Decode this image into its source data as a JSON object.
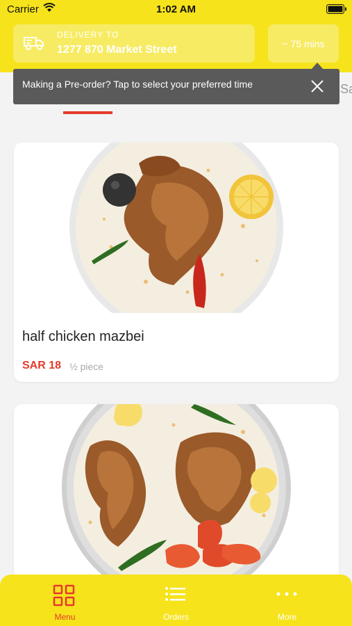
{
  "status_bar": {
    "carrier": "Carrier",
    "time": "1:02 AM"
  },
  "delivery": {
    "label": "DELIVERY TO",
    "address": "1277 870 Market Street",
    "eta": "~ 75 mins"
  },
  "tooltip": {
    "text": "Making a Pre-order? Tap to select your preferred time"
  },
  "category_tabs": {
    "next_tab_partial": "Sa"
  },
  "menu_items": [
    {
      "name": "half chicken mazbei",
      "price": "SAR 18",
      "portion": "½ piece"
    },
    {
      "name": "",
      "price": "",
      "portion": ""
    }
  ],
  "bottom_nav": {
    "items": [
      {
        "label": "Menu",
        "icon": "grid-icon",
        "active": true
      },
      {
        "label": "Orders",
        "icon": "list-icon",
        "active": false
      },
      {
        "label": "More",
        "icon": "more-icon",
        "active": false
      }
    ]
  },
  "colors": {
    "brand_yellow": "#f6e31c",
    "accent_red": "#e53a2b",
    "tooltip_gray": "#5a5a5a"
  }
}
